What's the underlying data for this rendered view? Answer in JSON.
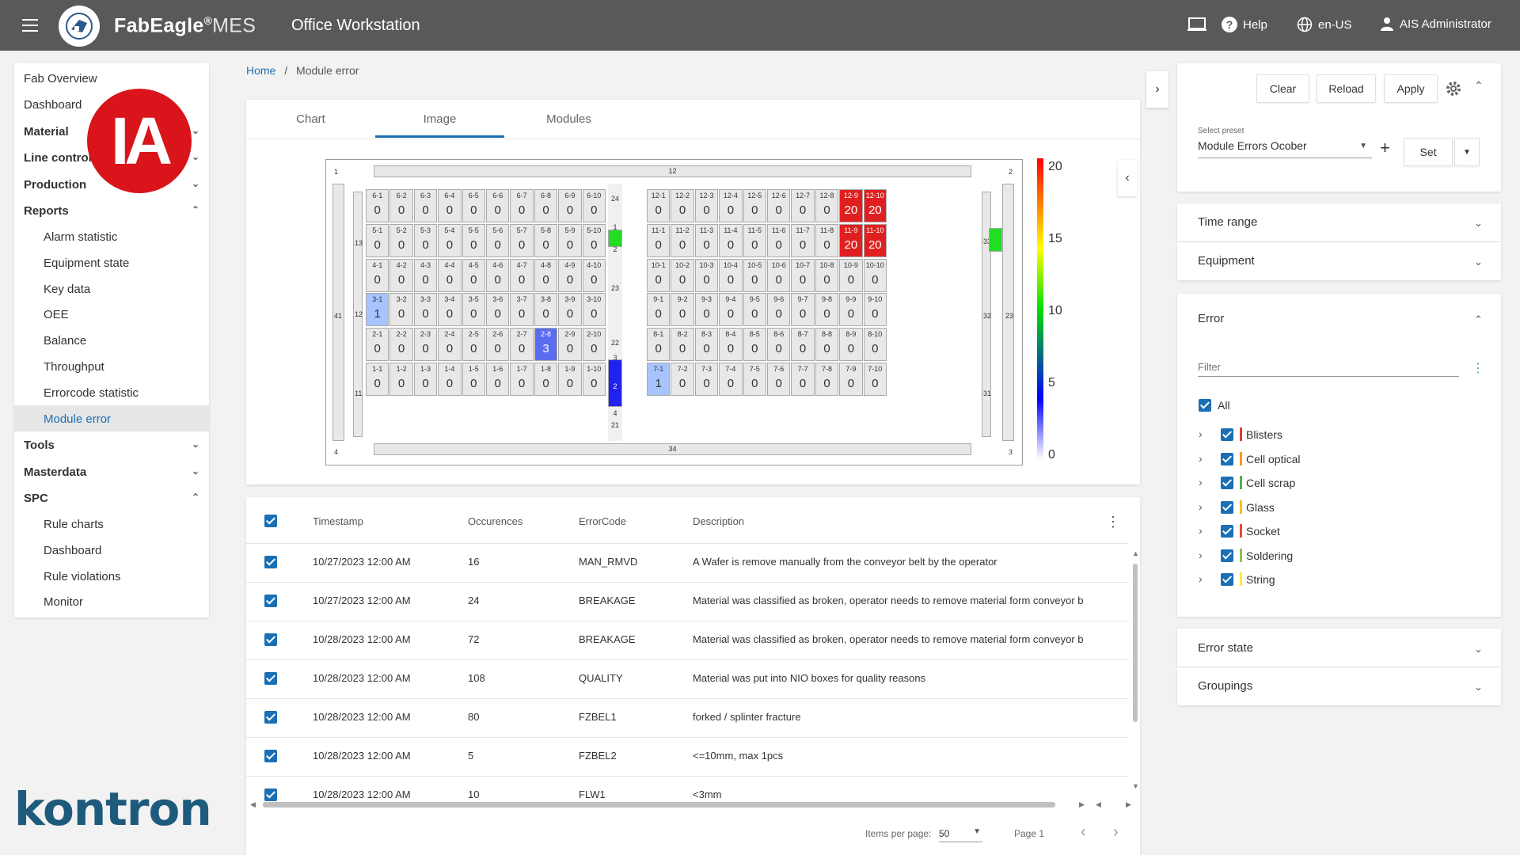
{
  "header": {
    "brand": "FabEagle",
    "brand_reg": "®",
    "brand_suffix": "MES",
    "workstation": "Office Workstation",
    "help": "Help",
    "language": "en-US",
    "user": "AIS Administrator"
  },
  "sidebar": {
    "items": [
      {
        "label": "Fab Overview",
        "type": "item"
      },
      {
        "label": "Dashboard",
        "type": "item"
      },
      {
        "label": "Material",
        "type": "group",
        "expanded": false
      },
      {
        "label": "Line control",
        "type": "group",
        "expanded": false
      },
      {
        "label": "Production",
        "type": "group",
        "expanded": false
      },
      {
        "label": "Reports",
        "type": "group",
        "expanded": true
      },
      {
        "label": "Alarm statistic",
        "type": "sub"
      },
      {
        "label": "Equipment state",
        "type": "sub"
      },
      {
        "label": "Key data",
        "type": "sub"
      },
      {
        "label": "OEE",
        "type": "sub"
      },
      {
        "label": "Balance",
        "type": "sub"
      },
      {
        "label": "Throughput",
        "type": "sub"
      },
      {
        "label": "Errorcode statistic",
        "type": "sub"
      },
      {
        "label": "Module error",
        "type": "sub",
        "active": true
      },
      {
        "label": "Tools",
        "type": "group",
        "expanded": false
      },
      {
        "label": "Masterdata",
        "type": "group",
        "expanded": false
      },
      {
        "label": "SPC",
        "type": "group",
        "expanded": true
      },
      {
        "label": "Rule charts",
        "type": "sub"
      },
      {
        "label": "Dashboard",
        "type": "sub"
      },
      {
        "label": "Rule violations",
        "type": "sub"
      },
      {
        "label": "Monitor",
        "type": "sub"
      }
    ]
  },
  "overlay_logo": "IA",
  "footer_logo": "kontron",
  "breadcrumb": {
    "home": "Home",
    "separator": "/",
    "current": "Module error"
  },
  "tabs": [
    {
      "label": "Chart",
      "active": false
    },
    {
      "label": "Image",
      "active": true
    },
    {
      "label": "Modules",
      "active": false
    }
  ],
  "legend": {
    "labels": [
      "20",
      "15",
      "10",
      "5",
      "0"
    ],
    "colors": [
      "#ff0000",
      "#ff8000",
      "#ffff00",
      "#00e000",
      "#0000ff",
      "#ffffff"
    ]
  },
  "colors": {
    "accent": "#1a6fb5",
    "topbar": "#595959",
    "high": "#e02020",
    "selected_low": "#a8c4ff",
    "selected_mid": "#5a6cf0",
    "green": "#22dd22",
    "blue_block": "#2222ee"
  },
  "heatmap": {
    "top_label": "12",
    "bottom_label": "34",
    "corner_labels": [
      "1",
      "2",
      "3",
      "4"
    ],
    "left_labels": [
      "41",
      "13",
      "12",
      "11"
    ],
    "center_labels": [
      "24",
      "1",
      "2",
      "23",
      "22",
      "3",
      "2",
      "4",
      "21"
    ],
    "right_labels": [
      "33",
      "32",
      "31",
      "23"
    ],
    "left_block": {
      "rows": [
        {
          "row": 6,
          "values": [
            0,
            0,
            0,
            0,
            0,
            0,
            0,
            0,
            0,
            0
          ]
        },
        {
          "row": 5,
          "values": [
            0,
            0,
            0,
            0,
            0,
            0,
            0,
            0,
            0,
            0
          ]
        },
        {
          "row": 4,
          "values": [
            0,
            0,
            0,
            0,
            0,
            0,
            0,
            0,
            0,
            0
          ]
        },
        {
          "row": 3,
          "values": [
            1,
            0,
            0,
            0,
            0,
            0,
            0,
            0,
            0,
            0
          ]
        },
        {
          "row": 2,
          "values": [
            0,
            0,
            0,
            0,
            0,
            0,
            0,
            3,
            0,
            0
          ]
        },
        {
          "row": 1,
          "values": [
            0,
            0,
            0,
            0,
            0,
            0,
            0,
            0,
            0,
            0
          ]
        }
      ]
    },
    "right_block": {
      "rows": [
        {
          "row": 12,
          "values": [
            0,
            0,
            0,
            0,
            0,
            0,
            0,
            0,
            20,
            20
          ]
        },
        {
          "row": 11,
          "values": [
            0,
            0,
            0,
            0,
            0,
            0,
            0,
            0,
            20,
            20
          ]
        },
        {
          "row": 10,
          "values": [
            0,
            0,
            0,
            0,
            0,
            0,
            0,
            0,
            0,
            0
          ]
        },
        {
          "row": 9,
          "values": [
            0,
            0,
            0,
            0,
            0,
            0,
            0,
            0,
            0,
            0
          ]
        },
        {
          "row": 8,
          "values": [
            0,
            0,
            0,
            0,
            0,
            0,
            0,
            0,
            0,
            0
          ]
        },
        {
          "row": 7,
          "values": [
            1,
            0,
            0,
            0,
            0,
            0,
            0,
            0,
            0,
            0
          ]
        }
      ]
    }
  },
  "table": {
    "headers": [
      "Timestamp",
      "Occurences",
      "ErrorCode",
      "Description"
    ],
    "rows": [
      {
        "timestamp": "10/27/2023 12:00 AM",
        "occurences": "16",
        "code": "MAN_RMVD",
        "description": "A Wafer is remove manually from the conveyor belt by the operator"
      },
      {
        "timestamp": "10/27/2023 12:00 AM",
        "occurences": "24",
        "code": "BREAKAGE",
        "description": "Material was classified as broken, operator needs to remove material form conveyor b"
      },
      {
        "timestamp": "10/28/2023 12:00 AM",
        "occurences": "72",
        "code": "BREAKAGE",
        "description": "Material was classified as broken, operator needs to remove material form conveyor b"
      },
      {
        "timestamp": "10/28/2023 12:00 AM",
        "occurences": "108",
        "code": "QUALITY",
        "description": "Material was put into NIO boxes for quality reasons"
      },
      {
        "timestamp": "10/28/2023 12:00 AM",
        "occurences": "80",
        "code": "FZBEL1",
        "description": "forked / splinter fracture"
      },
      {
        "timestamp": "10/28/2023 12:00 AM",
        "occurences": "5",
        "code": "FZBEL2",
        "description": "<=10mm, max 1pcs"
      },
      {
        "timestamp": "10/28/2023 12:00 AM",
        "occurences": "10",
        "code": "FLW1",
        "description": "<3mm"
      }
    ],
    "items_per_page_label": "Items per page:",
    "items_per_page": "50",
    "page_label": "Page 1"
  },
  "right_panel": {
    "buttons": {
      "clear": "Clear",
      "reload": "Reload",
      "apply": "Apply",
      "set": "Set"
    },
    "preset_label": "Select preset",
    "preset_value": "Module Errors Ocober",
    "sections": {
      "time_range": "Time range",
      "equipment": "Equipment",
      "error": "Error",
      "error_state": "Error state",
      "groupings": "Groupings"
    },
    "filter_placeholder": "Filter",
    "all_label": "All",
    "errors": [
      {
        "label": "Blisters",
        "color": "#e53935"
      },
      {
        "label": "Cell optical",
        "color": "#ff9800"
      },
      {
        "label": "Cell scrap",
        "color": "#4caf50"
      },
      {
        "label": "Glass",
        "color": "#ffc107"
      },
      {
        "label": "Socket",
        "color": "#f44336"
      },
      {
        "label": "Soldering",
        "color": "#8bc34a"
      },
      {
        "label": "String",
        "color": "#ffeb3b"
      }
    ]
  }
}
